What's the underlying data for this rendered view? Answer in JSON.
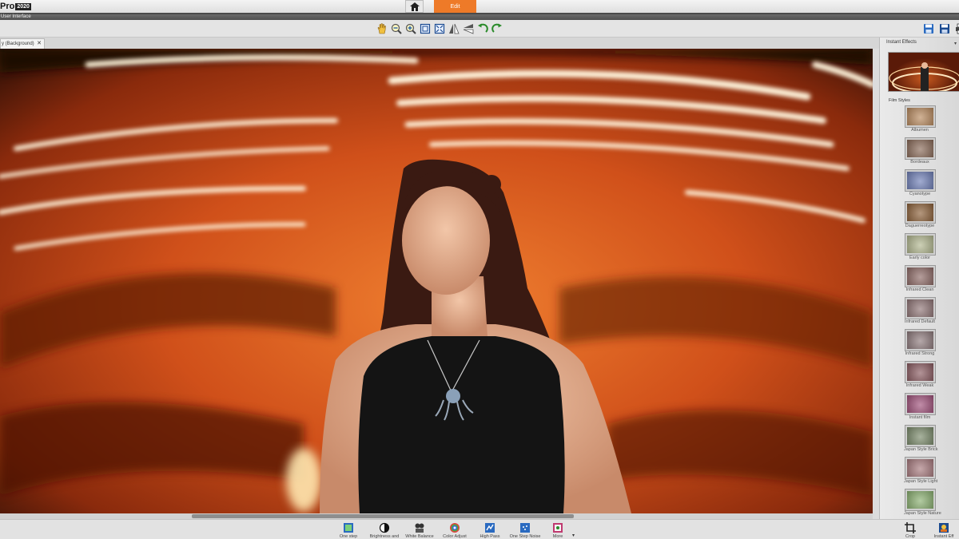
{
  "app": {
    "title_fragment": "Pro",
    "year": "2020"
  },
  "nav": {
    "home_icon": "home-icon",
    "edit_label": "Edit"
  },
  "window": {
    "menu_label": "User Interface"
  },
  "document": {
    "tab_label": "y (Background)",
    "close_glyph": "✕"
  },
  "toolbar": {
    "tools": [
      "hand-tool-icon",
      "zoom-out-icon",
      "zoom-in-icon",
      "fit-window-icon",
      "actual-size-icon",
      "flip-horizontal-icon",
      "flip-vertical-icon",
      "rotate-left-icon",
      "rotate-right-icon"
    ]
  },
  "panel": {
    "title": "Instant Effects",
    "section": "Film Styles",
    "effects": [
      {
        "label": "Albumen",
        "color": "#b98a5e"
      },
      {
        "label": "Bordeaux",
        "color": "#8a6a58"
      },
      {
        "label": "Cyanotype",
        "color": "#6f7fb8"
      },
      {
        "label": "Daguerreotype",
        "color": "#8c6038"
      },
      {
        "label": "Early color",
        "color": "#b2b78f"
      },
      {
        "label": "Infrared Clean",
        "color": "#8e6a66"
      },
      {
        "label": "Infrared Default",
        "color": "#907576"
      },
      {
        "label": "Infrared Strong",
        "color": "#8e7a7c"
      },
      {
        "label": "Infrared Weak",
        "color": "#8a5a60"
      },
      {
        "label": "Instant film",
        "color": "#a0507a"
      },
      {
        "label": "Japan Style Brick",
        "color": "#7a8a6a"
      },
      {
        "label": "Japan Style Light",
        "color": "#a87a7e"
      },
      {
        "label": "Japan Style Nature",
        "color": "#8ab070"
      }
    ]
  },
  "bottom": {
    "buttons": [
      {
        "label": "One step",
        "icon": "one-step-icon"
      },
      {
        "label": "Brightness and",
        "icon": "brightness-icon"
      },
      {
        "label": "White Balance",
        "icon": "white-balance-icon"
      },
      {
        "label": "Color Adjust",
        "icon": "color-adjust-icon"
      },
      {
        "label": "High Pass",
        "icon": "high-pass-icon"
      },
      {
        "label": "One Step Noise",
        "icon": "noise-icon"
      },
      {
        "label": "More",
        "icon": "more-icon"
      }
    ],
    "right": [
      {
        "label": "Crop",
        "icon": "crop-icon"
      },
      {
        "label": "Instant Eff",
        "icon": "instant-effects-icon"
      }
    ]
  }
}
